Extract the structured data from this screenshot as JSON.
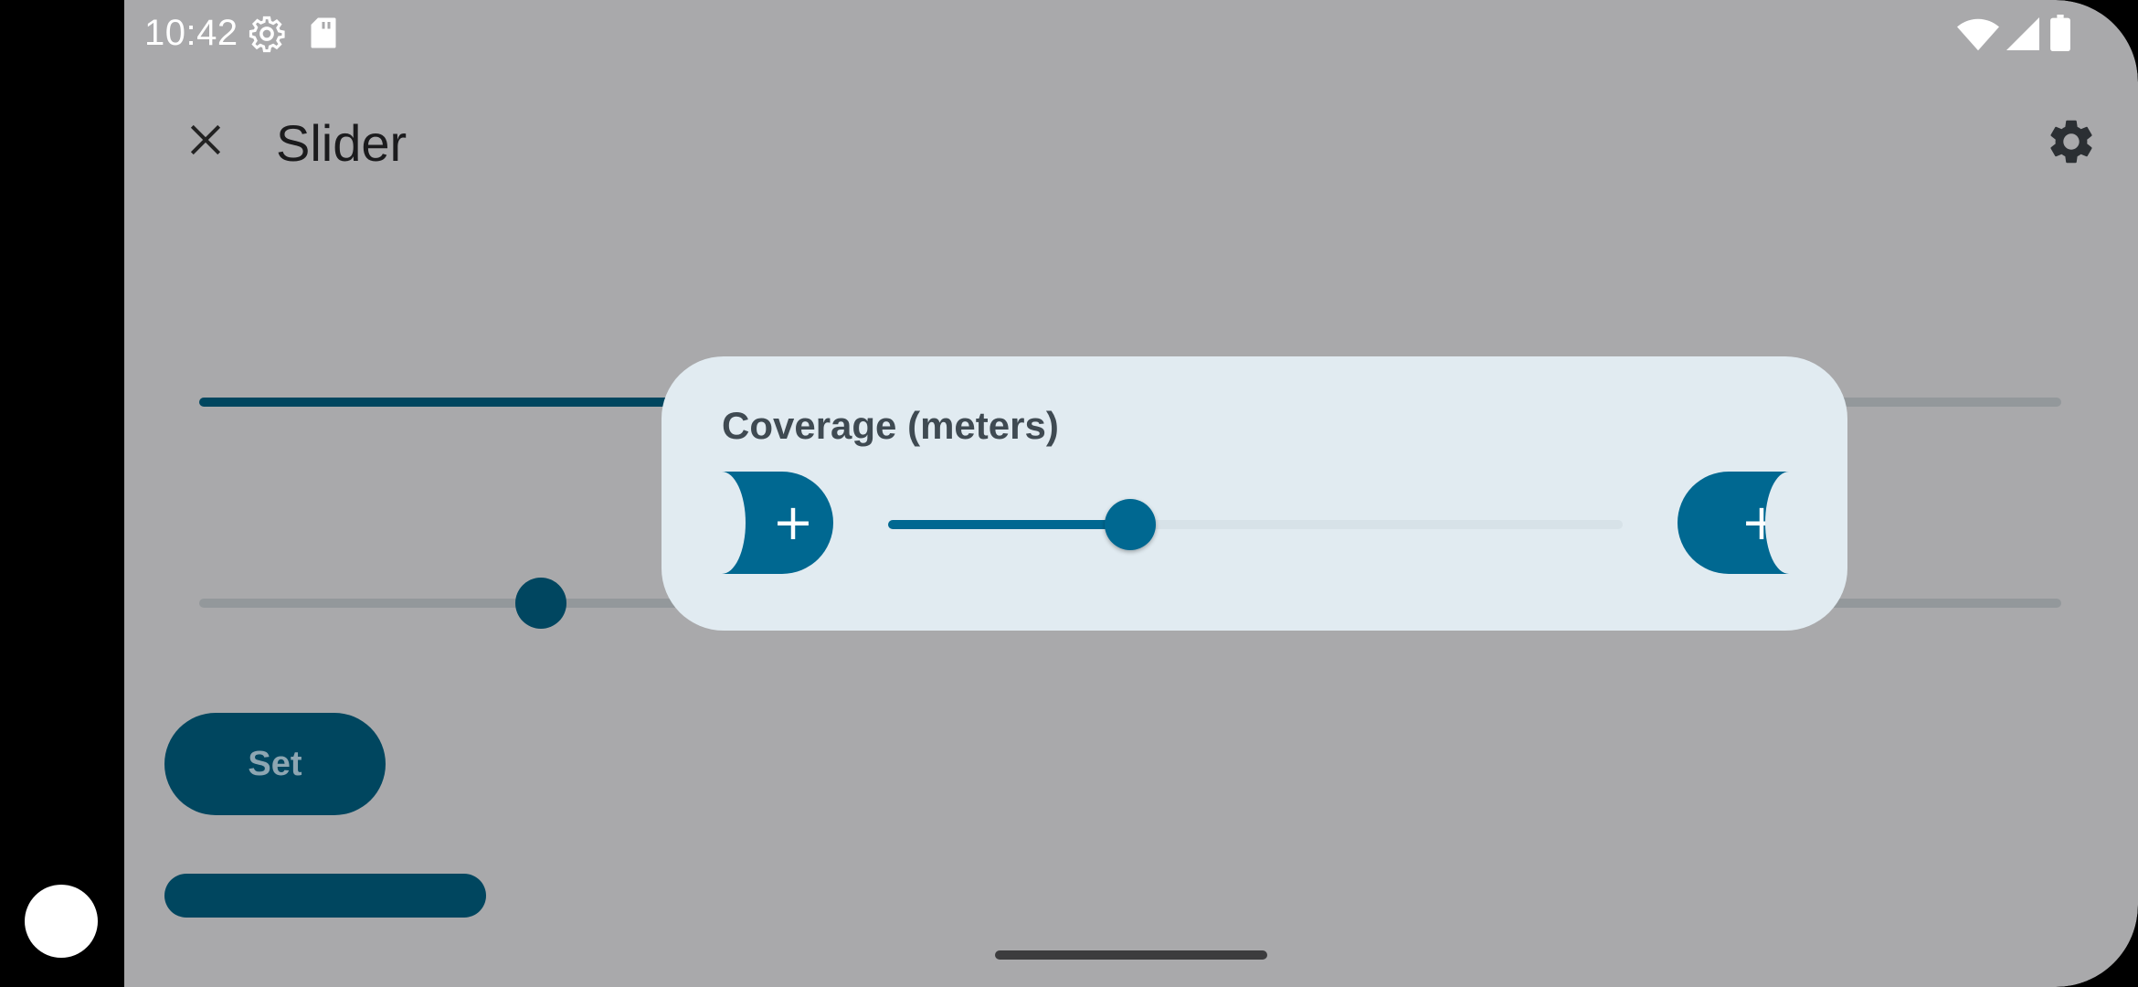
{
  "status_bar": {
    "time": "10:42",
    "icons": [
      "settings-gear-icon",
      "sd-card-icon",
      "wifi-icon",
      "cellular-signal-icon",
      "battery-icon"
    ]
  },
  "toolbar": {
    "title": "Slider",
    "close_icon": "close-icon",
    "settings_icon": "settings-icon"
  },
  "background_controls": {
    "set_button_label": "Set"
  },
  "dialog": {
    "title": "Coverage (meters)",
    "decrease_icon": "plus-icon",
    "increase_icon": "plus-icon",
    "decrease_glyph": "+",
    "increase_glyph": "+",
    "slider_fraction": 0.33
  },
  "colors": {
    "scrim_background": "#a9a9ab",
    "dialog_background": "#e1ebf1",
    "accent": "#006891",
    "dark_accent": "#00465f",
    "track_inactive": "#d7e2e8"
  }
}
